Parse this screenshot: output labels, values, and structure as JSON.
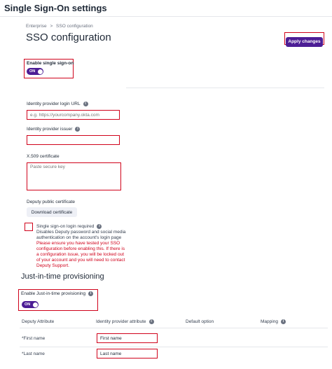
{
  "header": {
    "title": "Single Sign-On settings"
  },
  "breadcrumb": {
    "root": "Enterprise",
    "separator": ">",
    "current": "SSO configuration"
  },
  "page_title": "SSO configuration",
  "apply_button": "Apply changes",
  "enable_sso": {
    "label": "Enable single sign-on",
    "toggle": "ON"
  },
  "idp_login_url": {
    "label": "Identity provider login URL",
    "placeholder": "e.g. https://yourcompany.okta.com",
    "value": ""
  },
  "idp_issuer": {
    "label": "Identity provider issuer",
    "value": ""
  },
  "x509": {
    "label": "X.509 certificate",
    "placeholder": "Paste secure key"
  },
  "deputy_cert": {
    "label": "Deputy public certificate",
    "button": "Download certificate"
  },
  "sso_required": {
    "label": "Single sign-on login required",
    "description": "Disables Deputy password and social media authentication on the account's login page",
    "warning": "Please ensure you have tested your SSO configuration before enabling this. If there is a configuration issue, you will be locked out of your account and you will need to contact Deputy Support."
  },
  "jit": {
    "title": "Just-in-time provisioning",
    "label": "Enable Just-in-time provisioning",
    "toggle": "ON"
  },
  "table": {
    "columns": [
      "Deputy Attribute",
      "Identity provider attribute",
      "Default option",
      "Mapping"
    ],
    "rows": [
      {
        "attribute": "*First name",
        "idp_value": "First name"
      },
      {
        "attribute": "*Last name",
        "idp_value": "Last name"
      }
    ]
  },
  "colors": {
    "primary": "#4c1d95",
    "highlight": "#d0021b",
    "secondary_bg": "#eef0f6"
  }
}
